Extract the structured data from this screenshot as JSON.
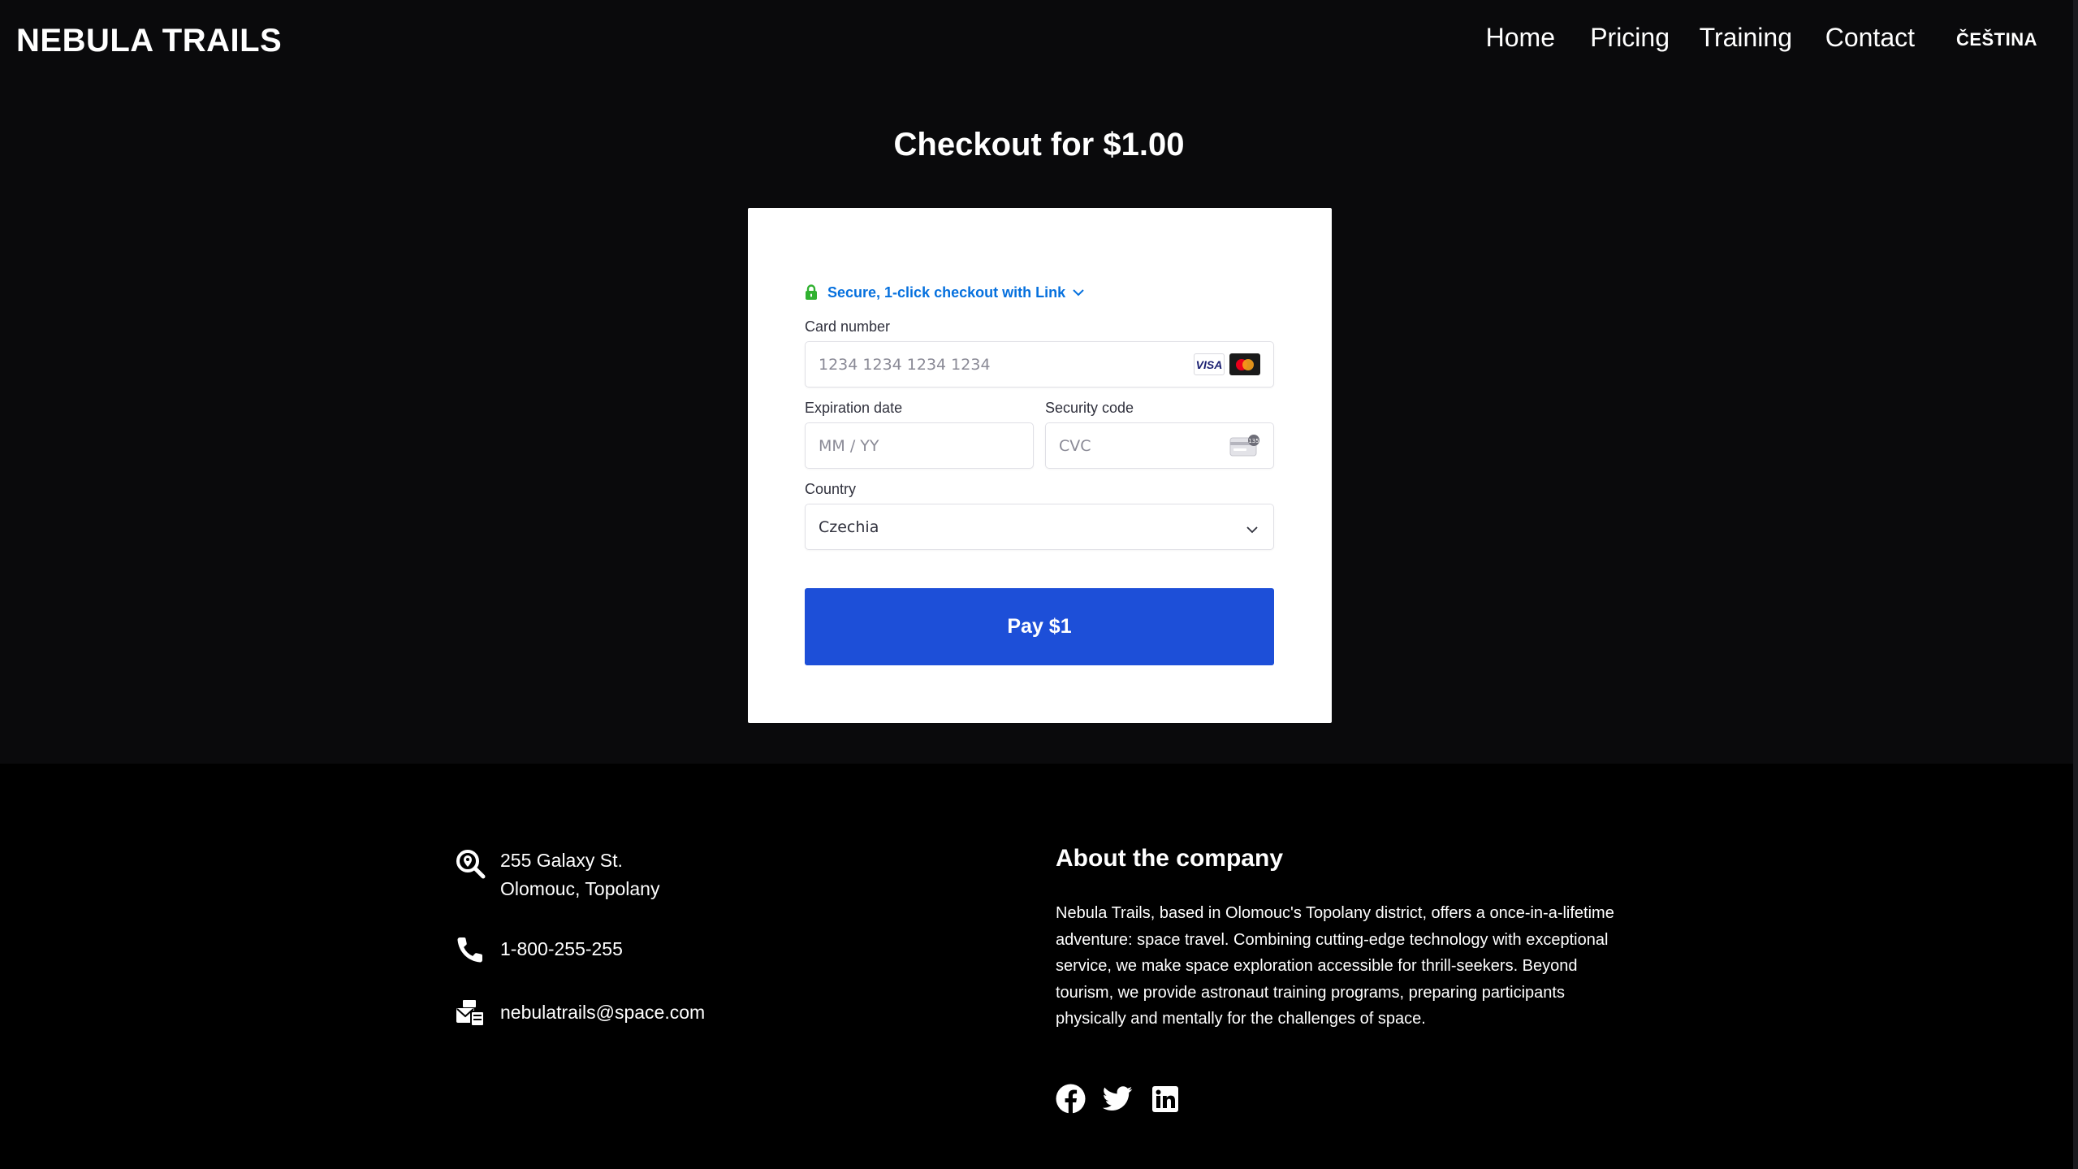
{
  "header": {
    "brand": "NEBULA TRAILS",
    "nav": [
      "Home",
      "Pricing",
      "Training",
      "Contact"
    ],
    "language": "ČEŠTINA"
  },
  "checkout": {
    "title": "Checkout for $1.00",
    "link_text": "Secure, 1-click checkout with Link",
    "card_number_label": "Card number",
    "card_number_placeholder": "1234 1234 1234 1234",
    "card_brands": [
      "VISA",
      "mastercard"
    ],
    "expiration_label": "Expiration date",
    "expiration_placeholder": "MM / YY",
    "security_label": "Security code",
    "security_placeholder": "CVC",
    "country_label": "Country",
    "country_value": "Czechia",
    "pay_label": "Pay $1",
    "colors": {
      "link": "#0570de",
      "lock": "#30b130",
      "pay_button": "#1d4fd8"
    }
  },
  "footer": {
    "address_line1": "255 Galaxy St.",
    "address_line2": "Olomouc, Topolany",
    "phone": "1-800-255-255",
    "email": "nebulatrails@space.com",
    "about_title": "About the company",
    "about_text": "Nebula Trails, based in Olomouc's Topolany district, offers a once-in-a-lifetime adventure: space travel. Combining cutting-edge technology with exceptional service, we make space exploration accessible for thrill-seekers. Beyond tourism, we provide astronaut training programs, preparing participants physically and mentally for the challenges of space.",
    "icons": [
      "location-search-icon",
      "phone-icon",
      "email-icon"
    ],
    "socials": [
      "facebook-icon",
      "twitter-icon",
      "linkedin-icon"
    ]
  }
}
